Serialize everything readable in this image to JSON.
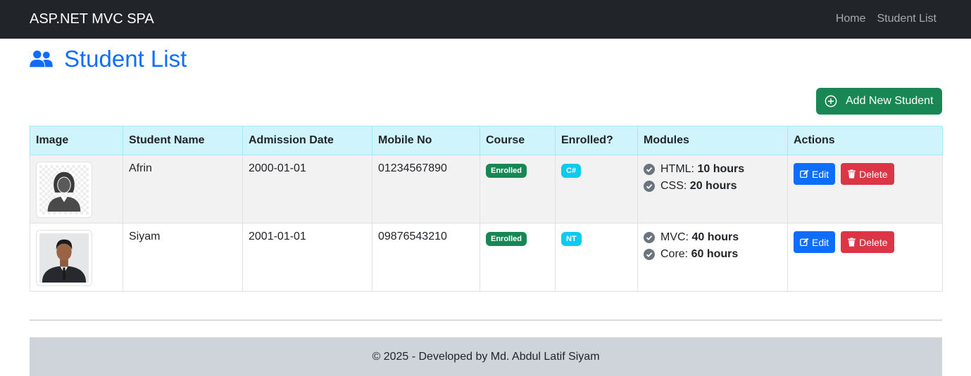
{
  "navbar": {
    "brand": "ASP.NET MVC SPA",
    "links": [
      {
        "label": "Home"
      },
      {
        "label": "Student List"
      }
    ]
  },
  "page": {
    "title": "Student List",
    "title_icon": "users-icon",
    "add_button_label": "Add New Student",
    "add_button_icon": "plus-circle-icon"
  },
  "table": {
    "headers": [
      "Image",
      "Student Name",
      "Admission Date",
      "Mobile No",
      "Course",
      "Enrolled?",
      "Modules",
      "Actions"
    ],
    "rows": [
      {
        "image": "female-avatar-placeholder",
        "name": "Afrin",
        "admission_date": "2000-01-01",
        "mobile": "01234567890",
        "status_badge": "Enrolled",
        "course_badge": "C#",
        "modules": [
          {
            "name": "HTML:",
            "duration": "10 hours"
          },
          {
            "name": "CSS:",
            "duration": "20 hours"
          }
        ],
        "edit_label": "Edit",
        "delete_label": "Delete"
      },
      {
        "image": "male-student-photo",
        "name": "Siyam",
        "admission_date": "2001-01-01",
        "mobile": "09876543210",
        "status_badge": "Enrolled",
        "course_badge": "NT",
        "modules": [
          {
            "name": "MVC:",
            "duration": "40 hours"
          },
          {
            "name": "Core:",
            "duration": "60 hours"
          }
        ],
        "edit_label": "Edit",
        "delete_label": "Delete"
      }
    ]
  },
  "footer": {
    "text": "© 2025 - Developed by Md. Abdul Latif Siyam"
  },
  "colors": {
    "navbar": "#212529",
    "primary": "#0d6efd",
    "success": "#198754",
    "info": "#0dcaf0",
    "danger": "#dc3545",
    "table_header": "#cff4fc",
    "footer": "#cfd4da"
  }
}
